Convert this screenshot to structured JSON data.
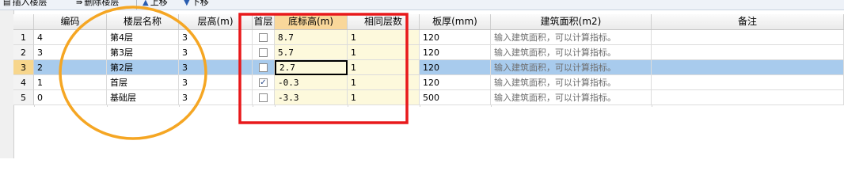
{
  "toolbar": {
    "insert_label": "插入楼层",
    "delete_label": "删除楼层",
    "up_label": "上移",
    "down_label": "下移"
  },
  "columns": [
    "编码",
    "楼层名称",
    "层高(m)",
    "首层",
    "底标高(m)",
    "相同层数",
    "板厚(mm)",
    "建筑面积(m2)",
    "备注"
  ],
  "rows": [
    {
      "num": "1",
      "code": "4",
      "name": "第4层",
      "height": "3",
      "first": false,
      "elev": "8.7",
      "same": "1",
      "thick": "120",
      "area": "输入建筑面积，可以计算指标。",
      "note": ""
    },
    {
      "num": "2",
      "code": "3",
      "name": "第3层",
      "height": "3",
      "first": false,
      "elev": "5.7",
      "same": "1",
      "thick": "120",
      "area": "输入建筑面积，可以计算指标。",
      "note": ""
    },
    {
      "num": "3",
      "code": "2",
      "name": "第2层",
      "height": "3",
      "first": false,
      "elev": "2.7",
      "same": "1",
      "thick": "120",
      "area": "输入建筑面积，可以计算指标。",
      "note": ""
    },
    {
      "num": "4",
      "code": "1",
      "name": "首层",
      "height": "3",
      "first": true,
      "elev": "-0.3",
      "same": "1",
      "thick": "120",
      "area": "输入建筑面积，可以计算指标。",
      "note": ""
    },
    {
      "num": "5",
      "code": "0",
      "name": "基础层",
      "height": "3",
      "first": false,
      "elev": "-3.3",
      "same": "1",
      "thick": "500",
      "area": "输入建筑面积，可以计算指标。",
      "note": ""
    }
  ],
  "selected_row": 3,
  "colors": {
    "selection": "#a8cbed",
    "editable_bg": "#fdf9dc",
    "annotation_circle": "#f5a623",
    "annotation_rect": "#e8191b"
  }
}
